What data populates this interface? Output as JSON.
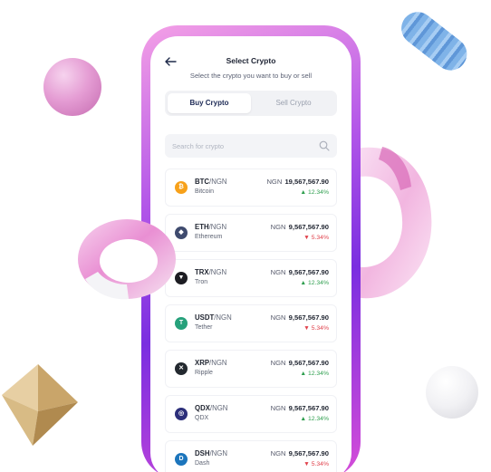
{
  "header": {
    "title": "Select Crypto",
    "subtitle": "Select the crypto you want to buy or sell"
  },
  "tabs": [
    {
      "label": "Buy Crypto",
      "active": true
    },
    {
      "label": "Sell Crypto",
      "active": false
    }
  ],
  "search": {
    "placeholder": "Search for crypto",
    "value": ""
  },
  "list": [
    {
      "symbol": "BTC",
      "quote": "/NGN",
      "name": "Bitcoin",
      "currency": "NGN",
      "price": "19,567,567.90",
      "arrow": "▲",
      "change": "12.34%",
      "direction": "up",
      "icon": "bitcoin-icon",
      "icon_glyph": "₿",
      "icon_color": "#f7a11a"
    },
    {
      "symbol": "ETH",
      "quote": "/NGN",
      "name": "Ethereum",
      "currency": "NGN",
      "price": "9,567,567.90",
      "arrow": "▼",
      "change": "5.34%",
      "direction": "down",
      "icon": "ethereum-icon",
      "icon_glyph": "◆",
      "icon_color": "#3f4b6e"
    },
    {
      "symbol": "TRX",
      "quote": "/NGN",
      "name": "Tron",
      "currency": "NGN",
      "price": "9,567,567.90",
      "arrow": "▲",
      "change": "12.34%",
      "direction": "up",
      "icon": "tron-icon",
      "icon_glyph": "▼",
      "icon_color": "#1c1c22"
    },
    {
      "symbol": "USDT",
      "quote": "/NGN",
      "name": "Tether",
      "currency": "NGN",
      "price": "9,567,567.90",
      "arrow": "▼",
      "change": "5.34%",
      "direction": "down",
      "icon": "tether-icon",
      "icon_glyph": "T",
      "icon_color": "#26a17b"
    },
    {
      "symbol": "XRP",
      "quote": "/NGN",
      "name": "Ripple",
      "currency": "NGN",
      "price": "9,567,567.90",
      "arrow": "▲",
      "change": "12.34%",
      "direction": "up",
      "icon": "ripple-icon",
      "icon_glyph": "✕",
      "icon_color": "#23292f"
    },
    {
      "symbol": "QDX",
      "quote": "/NGN",
      "name": "QDX",
      "currency": "NGN",
      "price": "9,567,567.90",
      "arrow": "▲",
      "change": "12.34%",
      "direction": "up",
      "icon": "qdx-icon",
      "icon_glyph": "◎",
      "icon_color": "#2c2f7a"
    },
    {
      "symbol": "DSH",
      "quote": "/NGN",
      "name": "Dash",
      "currency": "NGN",
      "price": "9,567,567.90",
      "arrow": "▼",
      "change": "5.34%",
      "direction": "down",
      "icon": "dash-icon",
      "icon_glyph": "D",
      "icon_color": "#1c75bc"
    }
  ],
  "colors": {
    "up": "#2e9e4e",
    "down": "#e0414b",
    "accent": "#7a2ee0"
  }
}
